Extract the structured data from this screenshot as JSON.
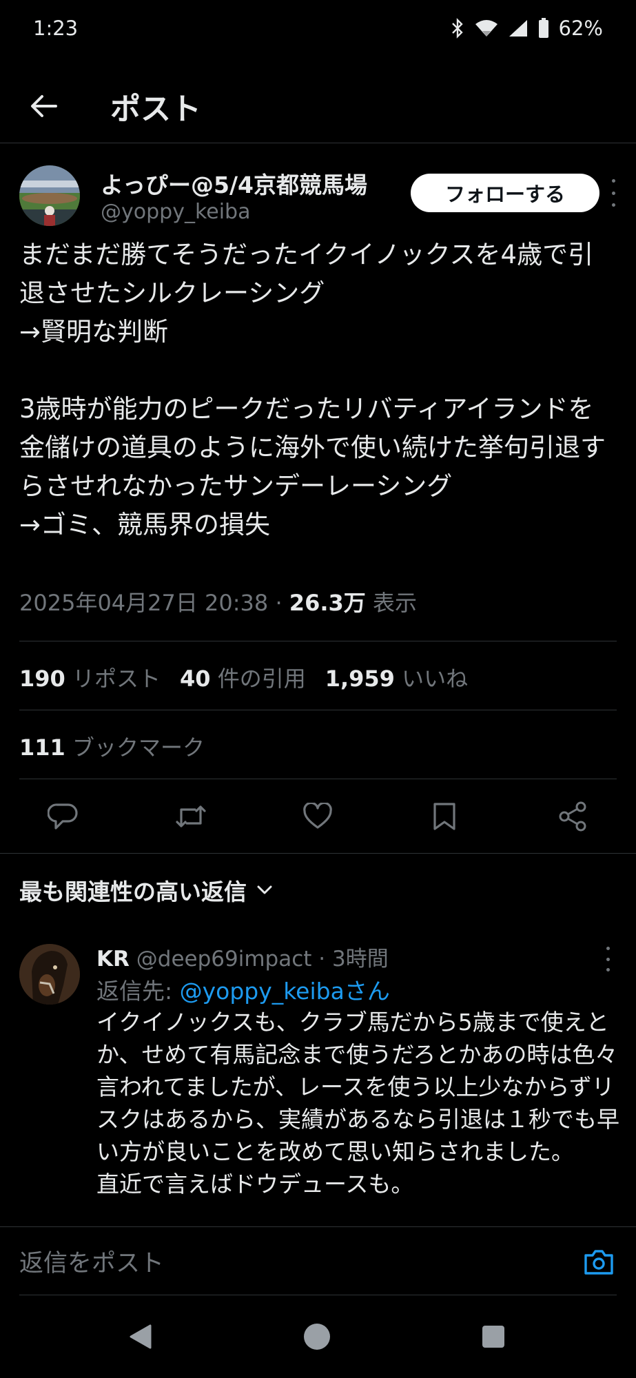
{
  "status_bar": {
    "time": "1:23",
    "battery": "62%"
  },
  "header": {
    "title": "ポスト"
  },
  "post": {
    "author_name": "よっぴー@5/4京都競馬場",
    "author_handle": "@yoppy_keiba",
    "follow_label": "フォローする",
    "text": "まだまだ勝てそうだったイクイノックスを4歳で引退させたシルクレーシング\n→賢明な判断\n\n3歳時が能力のピークだったリバティアイランドを金儲けの道具のように海外で使い続けた挙句引退すらさせれなかったサンデーレーシング\n→ゴミ、競馬界の損失",
    "timestamp": "2025年04月27日 20:38",
    "separator": " · ",
    "views_count": "26.3万",
    "views_label": " 表示"
  },
  "stats": {
    "reposts_count": "190",
    "reposts_label": " リポスト",
    "quotes_count": "40",
    "quotes_label": " 件の引用",
    "likes_count": "1,959",
    "likes_label": " いいね",
    "bookmarks_count": "111",
    "bookmarks_label": " ブックマーク"
  },
  "actions": {
    "icons": [
      "reply-icon",
      "repost-icon",
      "like-icon",
      "bookmark-icon",
      "share-icon"
    ]
  },
  "replies": {
    "sort_label": "最も関連性の高い返信",
    "items": [
      {
        "name": "KR",
        "handle": "@deep69impact",
        "time": " · 3時間",
        "reply_to_prefix": "返信先: ",
        "reply_to_mention": "@yoppy_keibaさん",
        "text": "イクイノックスも、クラブ馬だから5歳まで使えとか、せめて有馬記念まで使うだろとかあの時は色々言われてましたが、レースを使う以上少なからずリスクはあるから、実績があるなら引退は１秒でも早い方が良いことを改めて思い知らされました。\n直近で言えばドウデュースも。"
      }
    ]
  },
  "composer": {
    "placeholder": "返信をポスト"
  },
  "colors": {
    "background": "#000000",
    "text_primary": "#e7e9ea",
    "text_secondary": "#71767b",
    "accent": "#1d9bf0",
    "divider": "#2f3336"
  }
}
